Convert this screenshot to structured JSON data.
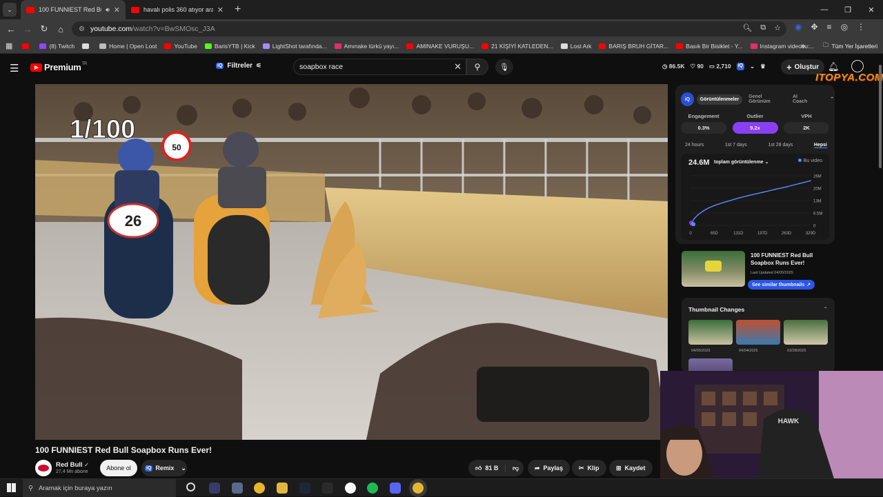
{
  "browser": {
    "tabs": [
      {
        "title": "100 FUNNIEST Red Bull Soa",
        "active": true
      },
      {
        "title": "havalı polis 360 atıyor arabayla",
        "active": false
      }
    ],
    "url_host": "youtube.com",
    "url_path": "/watch?v=BwSMOsc_J3A",
    "bookmarks": [
      {
        "label": "",
        "color": "#ff0000"
      },
      {
        "label": "(8) Twitch",
        "color": "#9146ff"
      },
      {
        "label": "",
        "color": "#dddddd"
      },
      {
        "label": "Home | Open Loot",
        "color": "#bbbbbb"
      },
      {
        "label": "YouTube",
        "color": "#ff0000"
      },
      {
        "label": "BarisYTB | Kick",
        "color": "#53fc18"
      },
      {
        "label": "LightShot tarafında...",
        "color": "#a48bff"
      },
      {
        "label": "Amınake türkü yayı...",
        "color": "#e1306c"
      },
      {
        "label": "AMINAKE VURUŞU...",
        "color": "#ff0000"
      },
      {
        "label": "21 KİŞİYİ KATLEDEN...",
        "color": "#ff0000"
      },
      {
        "label": "Lost Ark",
        "color": "#dddddd"
      },
      {
        "label": "BARIŞ BRUH GİTAR...",
        "color": "#ff0000"
      },
      {
        "label": "Basık Bir Bisiklet - Y...",
        "color": "#ff0000"
      },
      {
        "label": "Instagram videosu:...",
        "color": "#e1306c"
      }
    ],
    "bookmarks_more": "»",
    "all_bookmarks": "Tüm Yer İşaretleri"
  },
  "youtube": {
    "logo_text": "Premium",
    "logo_sup": "TR",
    "filters_label": "Filtreler",
    "search_value": "soapbox race",
    "header_stats": [
      "86.5K",
      "90",
      "2,710"
    ],
    "create_label": "Oluştur",
    "video_overlay": "1/100",
    "video_title": "100 FUNNIEST Red Bull Soapbox Runs Ever!",
    "channel_name": "Red Bull",
    "subscribers": "27,4 Mn abone",
    "subscribe_label": "Abone ol",
    "remix_label": "Remix",
    "likes": "81 B",
    "share_label": "Paylaş",
    "clip_label": "Klip",
    "save_label": "Kaydet",
    "watermark": "ITOPYA.COM"
  },
  "sidebar_panel": {
    "tabs": [
      "Görüntülenmeler",
      "Genel Görünüm",
      "AI Coach"
    ],
    "active_tab": "Görüntülenmeler",
    "metrics": [
      {
        "label": "Engagement",
        "value": "0.3%"
      },
      {
        "label": "Outlier",
        "value": "9.2x",
        "highlight": true
      },
      {
        "label": "VPH",
        "value": "2K"
      }
    ],
    "ranges": [
      "24 hours",
      "1st 7 days",
      "1st 28 days",
      "Hepsi"
    ],
    "active_range": "Hepsi",
    "total_views": "24.6M",
    "views_selector": "toplam görüntülenme",
    "legend": "Bu video",
    "thumb_title": "100 FUNNIEST Red Bull Soapbox Runs Ever!",
    "last_updated": "Last Updated 04/05/2025",
    "similar_label": "See similar thumbnails",
    "thumbnail_changes_title": "Thumbnail Changes",
    "thumbnail_dates": [
      "04/05/2025",
      "04/04/2025",
      "03/28/2025"
    ]
  },
  "chart_data": {
    "type": "line",
    "title": "",
    "xlabel": "",
    "ylabel": "",
    "x_ticks": [
      "0",
      "65D",
      "131D",
      "197D",
      "263D",
      "329D"
    ],
    "y_ticks": [
      "26M",
      "20M",
      "13M",
      "6.5M",
      "0"
    ],
    "x": [
      0,
      2,
      5,
      10,
      20,
      35,
      50,
      65,
      90,
      131,
      160,
      197,
      230,
      263,
      300,
      329
    ],
    "series": [
      {
        "values": [
          0.3,
          1.0,
          2.0,
          3.5,
          5.5,
          7.6,
          9.2,
          10.4,
          12.0,
          14.3,
          15.7,
          17.3,
          18.8,
          20.2,
          22.0,
          23.4
        ]
      }
    ],
    "ylim": [
      0,
      26
    ],
    "xlim": [
      0,
      329
    ],
    "grid": true,
    "legend_position": "top-right",
    "line_color": "#5b8cff"
  },
  "taskbar": {
    "search_placeholder": "Aramak için buraya yazın"
  }
}
